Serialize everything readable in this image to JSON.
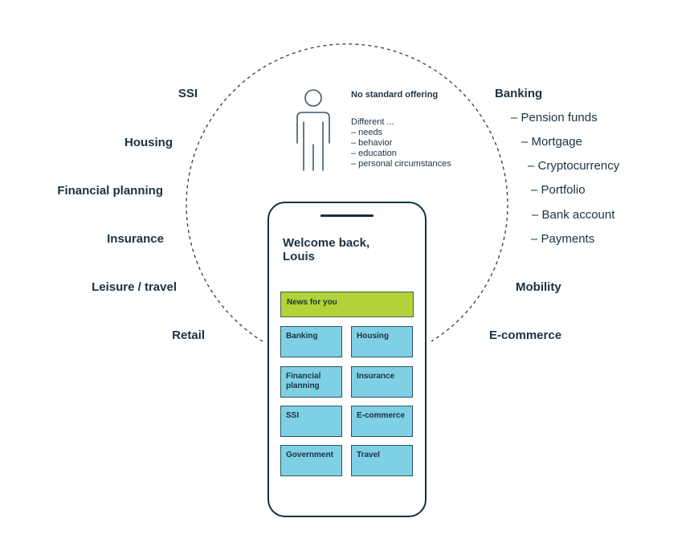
{
  "person": {
    "icon": "person-icon",
    "title": "No standard offering",
    "intro": "Different ...",
    "differences": [
      "– needs",
      "– behavior",
      "– education",
      "– personal circumstances"
    ]
  },
  "left_labels": [
    "SSI",
    "Housing",
    "Financial planning",
    "Insurance",
    "Leisure / travel",
    "Retail"
  ],
  "right_labels": {
    "banking": "Banking",
    "banking_subitems": [
      "– Pension funds",
      "– Mortgage",
      "– Cryptocurrency",
      "– Portfolio",
      "– Bank account",
      "– Payments"
    ],
    "mobility": "Mobility",
    "ecommerce": "E-commerce"
  },
  "phone": {
    "welcome": "Welcome back, Louis",
    "news_label": "News for you",
    "tiles": [
      "Banking",
      "Housing",
      "Financial planning",
      "Insurance",
      "SSI",
      "E-commerce",
      "Government",
      "Travel"
    ]
  },
  "colors": {
    "text": "#1b3243",
    "news": "#b2d23a",
    "tile": "#7fd0e4",
    "frame": "#15303f"
  }
}
